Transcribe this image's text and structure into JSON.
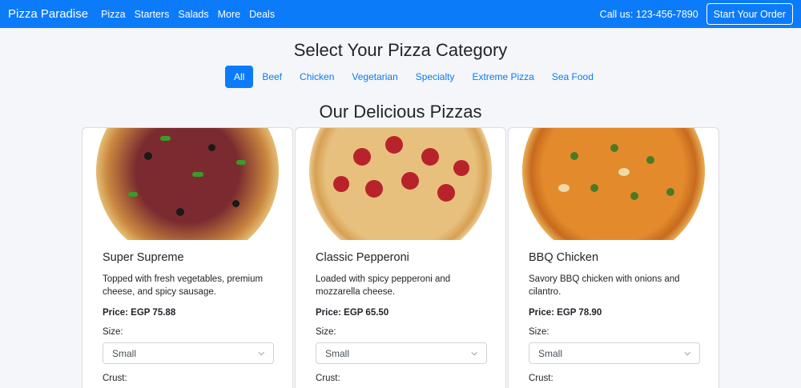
{
  "nav": {
    "brand": "Pizza Paradise",
    "links": [
      "Pizza",
      "Starters",
      "Salads",
      "More",
      "Deals"
    ],
    "phone": "Call us: 123-456-7890",
    "order_button": "Start Your Order"
  },
  "categories": {
    "title": "Select Your Pizza Category",
    "items": [
      "All",
      "Beef",
      "Chicken",
      "Vegetarian",
      "Specialty",
      "Extreme Pizza",
      "Sea Food"
    ],
    "active": "All"
  },
  "section_title": "Our Delicious Pizzas",
  "pizzas": [
    {
      "name": "Super Supreme",
      "description": "Topped with fresh vegetables, premium cheese, and spicy sausage.",
      "price": "Price: EGP 75.88",
      "size_label": "Size:",
      "size_value": "Small",
      "crust_label": "Crust:"
    },
    {
      "name": "Classic Pepperoni",
      "description": "Loaded with spicy pepperoni and mozzarella cheese.",
      "price": "Price: EGP 65.50",
      "size_label": "Size:",
      "size_value": "Small",
      "crust_label": "Crust:"
    },
    {
      "name": "BBQ Chicken",
      "description": "Savory BBQ chicken with onions and cilantro.",
      "price": "Price: EGP 78.90",
      "size_label": "Size:",
      "size_value": "Small",
      "crust_label": "Crust:"
    }
  ],
  "colors": {
    "primary": "#0b7bfa",
    "background": "#f4f6f9"
  }
}
